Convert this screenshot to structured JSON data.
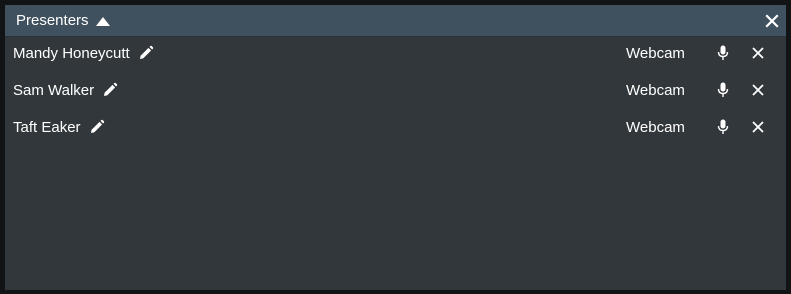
{
  "panel": {
    "title": "Presenters"
  },
  "presenters": [
    {
      "name": "Mandy Honeycutt",
      "source": "Webcam"
    },
    {
      "name": "Sam Walker",
      "source": "Webcam"
    },
    {
      "name": "Taft Eaker",
      "source": "Webcam"
    }
  ],
  "icons": {
    "collapse": "triangle-up-icon",
    "close": "close-icon",
    "edit": "pencil-icon",
    "mic": "microphone-icon",
    "remove": "close-icon"
  },
  "colors": {
    "header_bg": "#3f505e",
    "panel_bg": "#32373b",
    "text": "#ffffff"
  }
}
